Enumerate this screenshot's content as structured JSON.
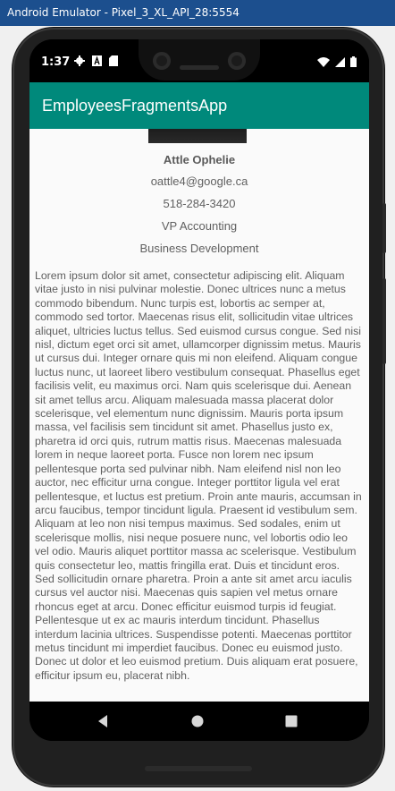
{
  "window": {
    "title": "Android Emulator - Pixel_3_XL_API_28:5554"
  },
  "status_bar": {
    "time": "1:37",
    "left_icons": [
      "gear-icon",
      "font-icon",
      "sd-card-icon"
    ],
    "right_icons": [
      "wifi-icon",
      "signal-icon",
      "battery-icon"
    ]
  },
  "app_bar": {
    "title": "EmployeesFragmentsApp"
  },
  "employee": {
    "name": "Attle Ophelie",
    "email": "oattle4@google.ca",
    "phone": "518-284-3420",
    "title": "VP Accounting",
    "department": "Business Development",
    "bio": "Lorem ipsum dolor sit amet, consectetur adipiscing elit. Aliquam vitae justo in nisi pulvinar molestie. Donec ultrices nunc a metus commodo bibendum. Nunc turpis est, lobortis ac semper at, commodo sed tortor. Maecenas risus elit, sollicitudin vitae ultrices aliquet, ultricies luctus tellus. Sed euismod cursus congue. Sed nisi nisl, dictum eget orci sit amet, ullamcorper dignissim metus. Mauris ut cursus dui. Integer ornare quis mi non eleifend. Aliquam congue luctus nunc, ut laoreet libero vestibulum consequat. Phasellus eget facilisis velit, eu maximus orci. Nam quis scelerisque dui. Aenean sit amet tellus arcu. Aliquam malesuada massa placerat dolor scelerisque, vel elementum nunc dignissim. Mauris porta ipsum massa, vel facilisis sem tincidunt sit amet. Phasellus justo ex, pharetra id orci quis, rutrum mattis risus. Maecenas malesuada lorem in neque laoreet porta. Fusce non lorem nec ipsum pellentesque porta sed pulvinar nibh. Nam eleifend nisl non leo auctor, nec efficitur urna congue. Integer porttitor ligula vel erat pellentesque, et luctus est pretium. Proin ante mauris, accumsan in arcu faucibus, tempor tincidunt ligula. Praesent id vestibulum sem. Aliquam at leo non nisi tempus maximus. Sed sodales, enim ut scelerisque mollis, nisi neque posuere nunc, vel lobortis odio leo vel odio. Mauris aliquet porttitor massa ac scelerisque. Vestibulum quis consectetur leo, mattis fringilla erat. Duis et tincidunt eros. Sed sollicitudin ornare pharetra. Proin a ante sit amet arcu iaculis cursus vel auctor nisi. Maecenas quis sapien vel metus ornare rhoncus eget at arcu. Donec efficitur euismod turpis id feugiat. Pellentesque ut ex ac mauris interdum tincidunt. Phasellus interdum lacinia ultrices. Suspendisse potenti. Maecenas porttitor metus tincidunt mi imperdiet faucibus. Donec eu euismod justo. Donec ut dolor et leo euismod pretium. Duis aliquam erat posuere, efficitur ipsum eu, placerat nibh."
  },
  "nav": {
    "buttons": [
      "back-icon",
      "home-icon",
      "recents-icon"
    ]
  },
  "colors": {
    "accent": "#00897b",
    "window_title_bar": "#1c4f8e"
  }
}
